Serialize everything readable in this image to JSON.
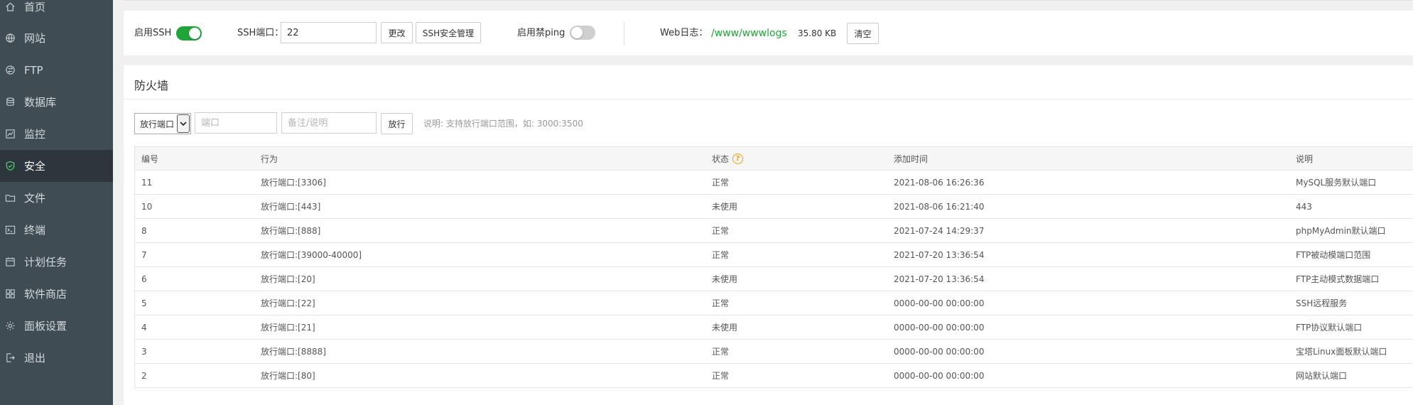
{
  "sidebar": {
    "items": [
      {
        "label": "首页",
        "icon": "home-icon"
      },
      {
        "label": "网站",
        "icon": "globe-icon"
      },
      {
        "label": "FTP",
        "icon": "ftp-icon"
      },
      {
        "label": "数据库",
        "icon": "database-icon"
      },
      {
        "label": "监控",
        "icon": "monitor-icon"
      },
      {
        "label": "安全",
        "icon": "shield-icon",
        "active": true
      },
      {
        "label": "文件",
        "icon": "folder-icon"
      },
      {
        "label": "终端",
        "icon": "terminal-icon"
      },
      {
        "label": "计划任务",
        "icon": "calendar-icon"
      },
      {
        "label": "软件商店",
        "icon": "apps-icon"
      },
      {
        "label": "面板设置",
        "icon": "gear-icon"
      },
      {
        "label": "退出",
        "icon": "logout-icon"
      }
    ]
  },
  "top": {
    "ssh_enable_label": "启用SSH",
    "ssh_enabled": true,
    "ssh_port_label": "SSH端口：",
    "ssh_port_value": "22",
    "change_button": "更改",
    "ssh_manage_button": "SSH安全管理",
    "ping_label": "启用禁ping",
    "ping_enabled": false,
    "weblog_label": "Web日志：",
    "weblog_path": "/www/wwwlogs",
    "weblog_size": "35.80 KB",
    "clear_button": "清空"
  },
  "firewall": {
    "title": "防火墙",
    "select_value": "放行端口",
    "port_placeholder": "端口",
    "note_placeholder": "备注/说明",
    "allow_button": "放行",
    "hint": "说明: 支持放行端口范围，如: 3000:3500",
    "columns": [
      "编号",
      "行为",
      "状态",
      "添加时间",
      "说明"
    ],
    "rows": [
      {
        "id": "11",
        "action": "放行端口:[3306]",
        "status": "正常",
        "time": "2021-08-06 16:26:36",
        "desc": "MySQL服务默认端口"
      },
      {
        "id": "10",
        "action": "放行端口:[443]",
        "status": "未使用",
        "time": "2021-08-06 16:21:40",
        "desc": "443"
      },
      {
        "id": "8",
        "action": "放行端口:[888]",
        "status": "正常",
        "time": "2021-07-24 14:29:37",
        "desc": "phpMyAdmin默认端口"
      },
      {
        "id": "7",
        "action": "放行端口:[39000-40000]",
        "status": "正常",
        "time": "2021-07-20 13:36:54",
        "desc": "FTP被动模端口范围"
      },
      {
        "id": "6",
        "action": "放行端口:[20]",
        "status": "未使用",
        "time": "2021-07-20 13:36:54",
        "desc": "FTP主动模式数据端口"
      },
      {
        "id": "5",
        "action": "放行端口:[22]",
        "status": "正常",
        "time": "0000-00-00 00:00:00",
        "desc": "SSH远程服务"
      },
      {
        "id": "4",
        "action": "放行端口:[21]",
        "status": "未使用",
        "time": "0000-00-00 00:00:00",
        "desc": "FTP协议默认端口"
      },
      {
        "id": "3",
        "action": "放行端口:[8888]",
        "status": "正常",
        "time": "0000-00-00 00:00:00",
        "desc": "宝塔Linux面板默认端口"
      },
      {
        "id": "2",
        "action": "放行端口:[80]",
        "status": "正常",
        "time": "0000-00-00 00:00:00",
        "desc": "网站默认端口"
      }
    ]
  },
  "colors": {
    "sidebar_bg": "#3f4c54",
    "sidebar_active": "#2c363c",
    "accent": "#20a53a",
    "help": "#f39c12"
  }
}
